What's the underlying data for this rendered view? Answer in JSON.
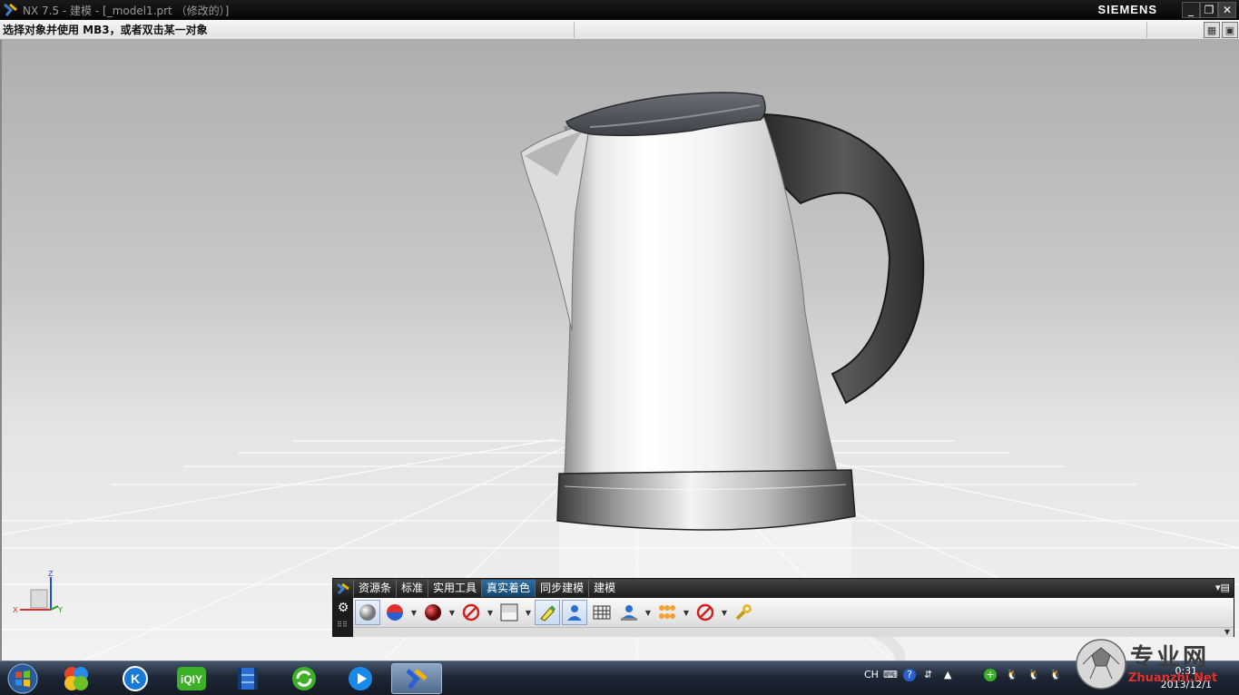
{
  "window": {
    "title": "NX 7.5 - 建模 - [_model1.prt （修改的）]",
    "brand": "SIEMENS",
    "minimize": "_",
    "restore": "❐",
    "close": "✕"
  },
  "cueline": {
    "prompt": "选择对象并使用 MB3，或者双击某一对象"
  },
  "viewport": {
    "background_top": "#aeaeae",
    "background_bottom": "#f2f2f2",
    "model": "kettle",
    "triad": {
      "x": "X",
      "y": "Y",
      "z": "Z"
    }
  },
  "float_toolbar": {
    "tabs": [
      {
        "label": "资源条",
        "active": false
      },
      {
        "label": "标准",
        "active": false
      },
      {
        "label": "实用工具",
        "active": false
      },
      {
        "label": "真实着色",
        "active": true
      },
      {
        "label": "同步建模",
        "active": false
      },
      {
        "label": "建模",
        "active": false
      }
    ],
    "tools": [
      {
        "icon": "sphere-shade-icon"
      },
      {
        "icon": "material-ball-icon"
      },
      {
        "icon": "red-ball-icon"
      },
      {
        "icon": "no-sign-icon"
      },
      {
        "icon": "background-panel-icon"
      },
      {
        "icon": "highlight-pen-icon"
      },
      {
        "icon": "user-light-icon"
      },
      {
        "icon": "floor-grid-icon"
      },
      {
        "icon": "user-display-icon"
      },
      {
        "icon": "molecule-icon"
      },
      {
        "icon": "no-sign-icon"
      },
      {
        "icon": "wrench-icon"
      }
    ]
  },
  "taskbar": {
    "apps": [
      {
        "icon": "windows-start-icon"
      },
      {
        "icon": "app-butterfly-icon"
      },
      {
        "icon": "kugou-icon"
      },
      {
        "icon": "iqiyi-icon"
      },
      {
        "icon": "film-icon"
      },
      {
        "icon": "refresh-browser-icon"
      },
      {
        "icon": "media-play-icon"
      },
      {
        "icon": "nx-icon"
      }
    ],
    "iqiyi_label": "iQIY",
    "kugou_label": "K",
    "tray_lang": "CH",
    "clock_time": "0:31",
    "clock_date": "2013/12/1"
  },
  "watermark": {
    "text": "专业网",
    "sub": "Zhuanzhi.Net"
  }
}
